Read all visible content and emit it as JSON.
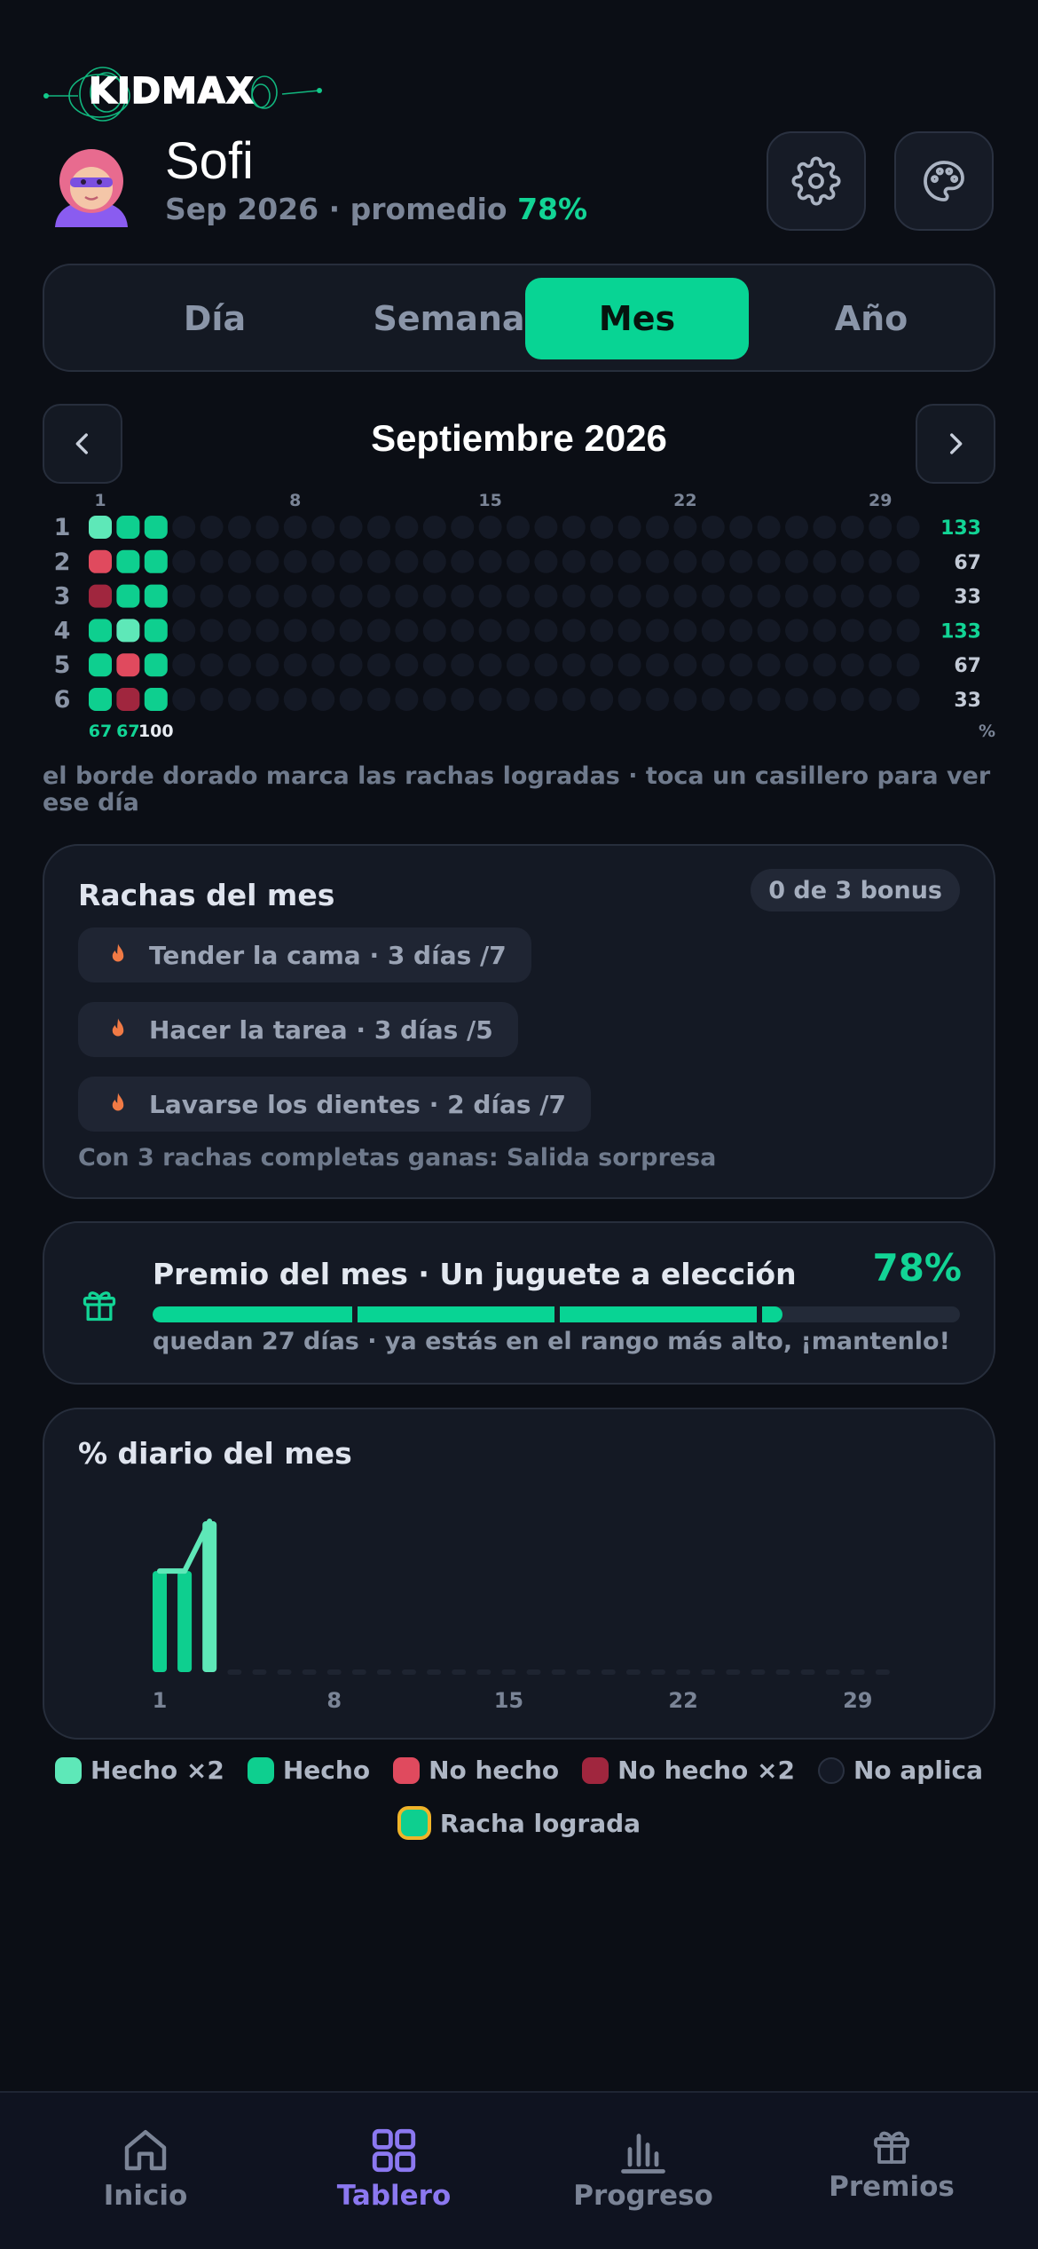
{
  "app": {
    "logo_text": "KIDMAX"
  },
  "profile": {
    "name": "Sofi",
    "period": "Sep 2026",
    "avg_label": "promedio",
    "avg_value": "78%",
    "separator": " · "
  },
  "header_buttons": [
    {
      "icon": "gear-icon"
    },
    {
      "icon": "palette-icon"
    }
  ],
  "tabs": [
    {
      "label": "Día",
      "active": false
    },
    {
      "label": "Semana",
      "active": false
    },
    {
      "label": "Mes",
      "active": true
    },
    {
      "label": "Año",
      "active": false
    }
  ],
  "calendar": {
    "title": "Septiembre 2026",
    "day_ticks": [
      "1",
      "8",
      "15",
      "22",
      "29"
    ],
    "rows": [
      {
        "label": "1",
        "cells": [
          "done2",
          "done",
          "done"
        ],
        "total": "133",
        "total_highlight": true
      },
      {
        "label": "2",
        "cells": [
          "notdone",
          "done",
          "done"
        ],
        "total": "67",
        "total_highlight": false
      },
      {
        "label": "3",
        "cells": [
          "notdone2",
          "done",
          "done"
        ],
        "total": "33",
        "total_highlight": false
      },
      {
        "label": "4",
        "cells": [
          "done",
          "done2",
          "done"
        ],
        "total": "133",
        "total_highlight": true
      },
      {
        "label": "5",
        "cells": [
          "done",
          "notdone",
          "done"
        ],
        "total": "67",
        "total_highlight": false
      },
      {
        "label": "6",
        "cells": [
          "done",
          "notdone2",
          "done"
        ],
        "total": "33",
        "total_highlight": false
      }
    ],
    "days_in_month": 30,
    "column_totals": [
      "67",
      "67",
      "100"
    ],
    "percent_symbol": "%",
    "hint": "el borde dorado marca las rachas logradas · toca un casillero para ver ese día"
  },
  "streaks": {
    "title": "Rachas del mes",
    "bonus": "0 de 3 bonus",
    "items": [
      {
        "label": "Tender la cama · 3 días /7"
      },
      {
        "label": "Hacer la tarea · 3 días /5"
      },
      {
        "label": "Lavarse los dientes · 2 días /7"
      }
    ],
    "footer": "Con 3 rachas completas ganas: Salida sorpresa"
  },
  "prize": {
    "title": "Premio del mes · Un juguete a elección",
    "percent": "78%",
    "progress": 0.78,
    "subtitle": "quedan 27 días · ya estás en el rango más alto, ¡mantenlo!"
  },
  "daily_chart": {
    "title": "% diario del mes",
    "chart_data": {
      "type": "bar",
      "x": [
        1,
        2,
        3
      ],
      "values": [
        67,
        67,
        100
      ],
      "days": 30,
      "x_ticks": [
        "1",
        "8",
        "15",
        "22",
        "29"
      ],
      "ylim": [
        0,
        100
      ],
      "overlay_line": true
    }
  },
  "legend": {
    "row1": [
      {
        "label": "Hecho ×2",
        "color": "#5ee8b8"
      },
      {
        "label": "Hecho",
        "color": "#0ecf8f"
      },
      {
        "label": "No hecho",
        "color": "#e04a5e"
      },
      {
        "label": "No hecho ×2",
        "color": "#a0263e"
      },
      {
        "label": "No aplica",
        "color": "#141925"
      }
    ],
    "row2": [
      {
        "label": "Racha lograda",
        "color": "#0ecf8f",
        "border": "#f0b429"
      }
    ]
  },
  "bottom_nav": [
    {
      "label": "Inicio",
      "icon": "home-icon",
      "active": false
    },
    {
      "label": "Tablero",
      "icon": "grid-icon",
      "active": true
    },
    {
      "label": "Progreso",
      "icon": "bar-chart-icon",
      "active": false
    },
    {
      "label": "Premios",
      "icon": "gift-icon",
      "active": false
    }
  ],
  "colors": {
    "accent": "#08d494",
    "accent_light": "#5ee8b8",
    "danger": "#e04a5e",
    "danger_dark": "#a0263e",
    "nav_active": "#8b78f0",
    "streak_flame": "#f07a45"
  }
}
